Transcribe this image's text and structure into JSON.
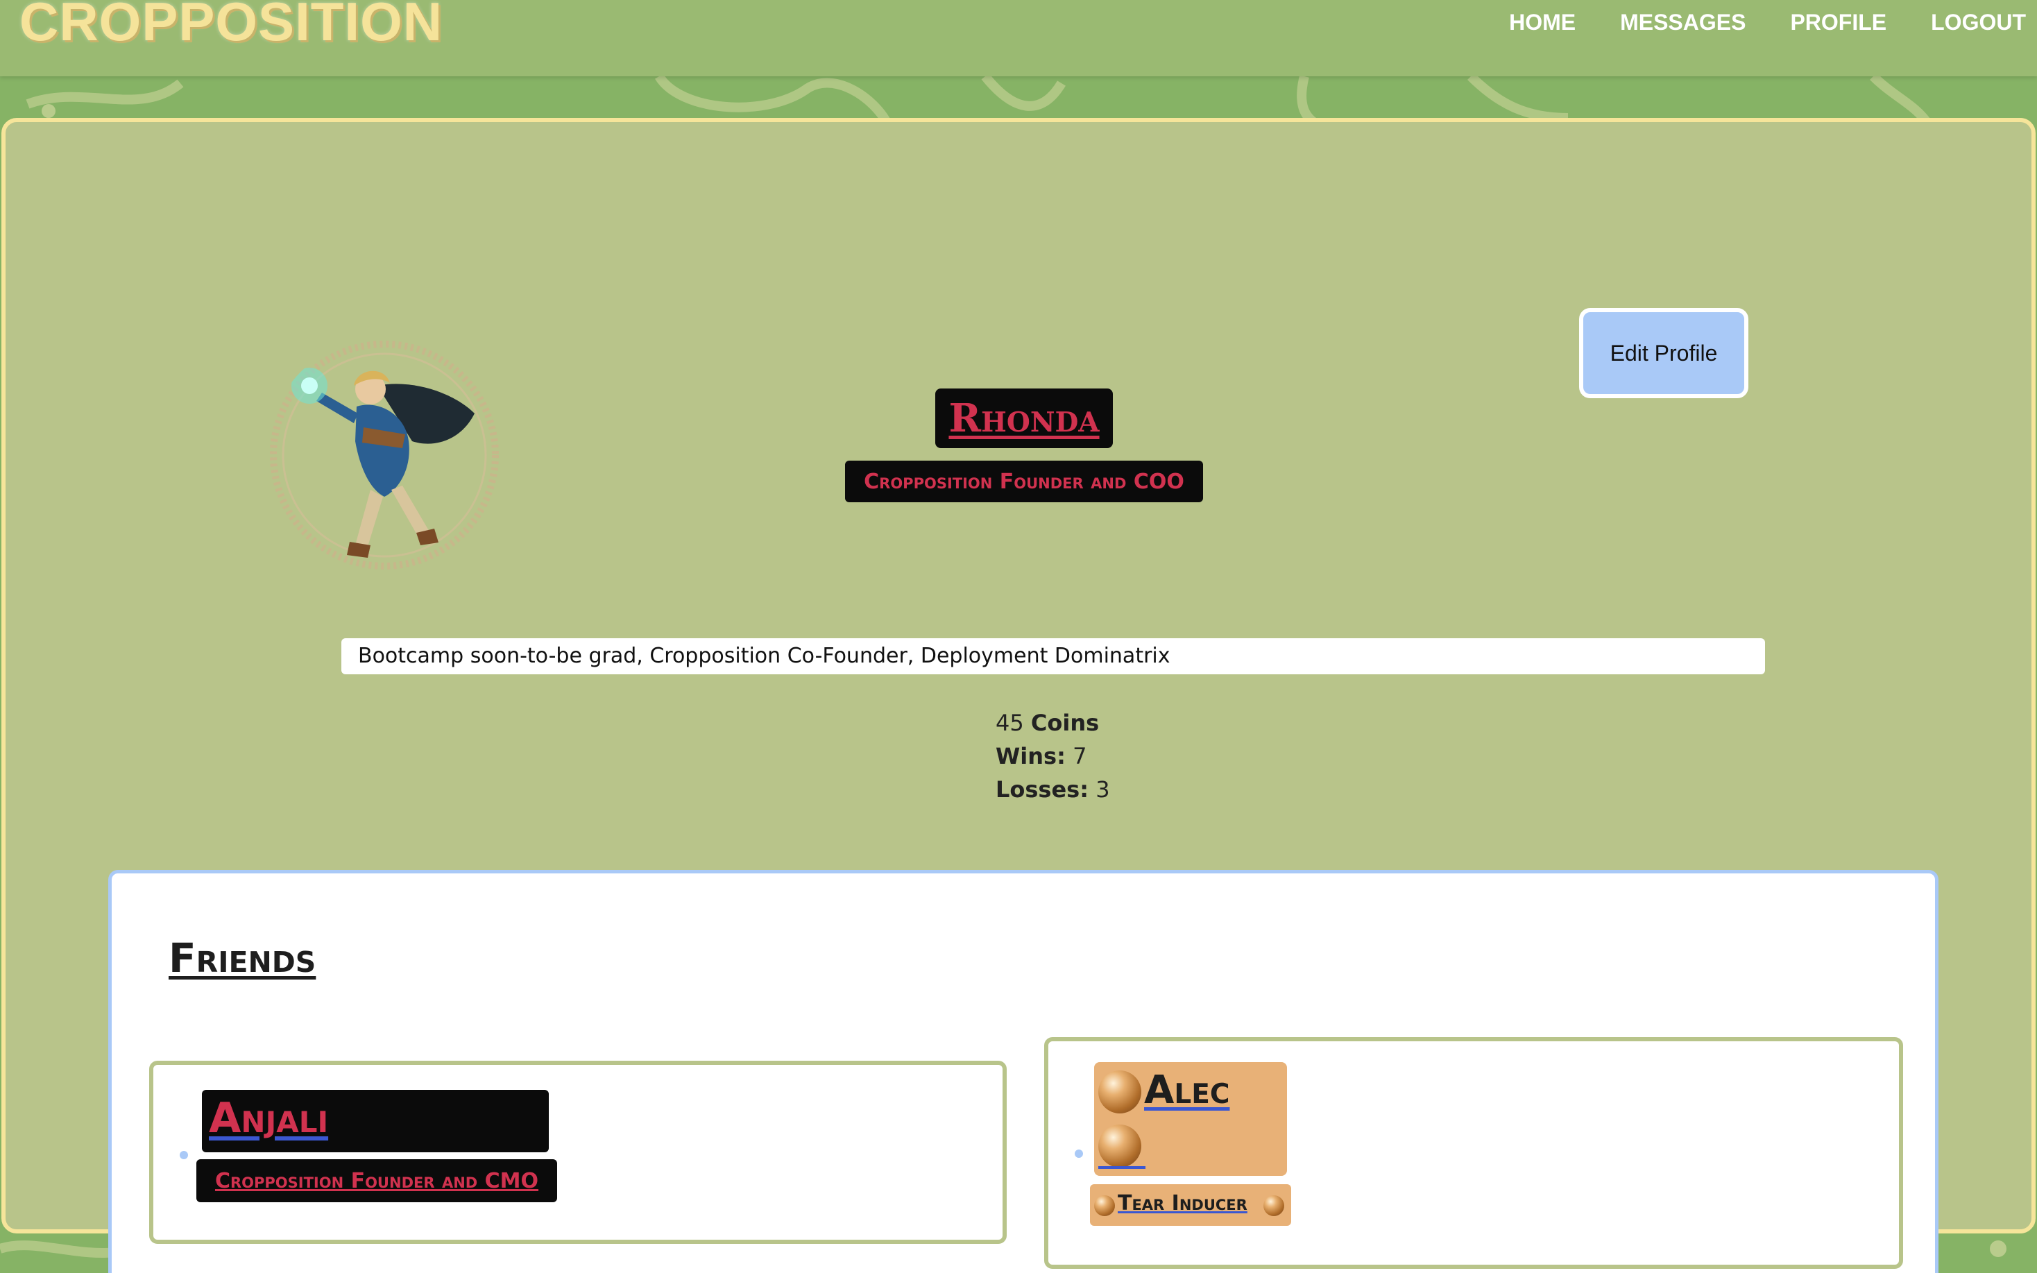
{
  "brand": "CROPPOSITION",
  "nav": {
    "home": "HOME",
    "messages": "MESSAGES",
    "profile": "PROFILE",
    "logout": "LOGOUT"
  },
  "profile": {
    "name": "Rhonda",
    "title": "Cropposition Founder and COO",
    "edit_label": "Edit Profile",
    "bio": "Bootcamp soon-to-be grad, Cropposition Co-Founder, Deployment Dominatrix",
    "coins_value": "45",
    "coins_label": "Coins",
    "wins_label": "Wins:",
    "wins_value": "7",
    "losses_label": "Losses:",
    "losses_value": "3"
  },
  "friends": {
    "heading": "Friends",
    "items": [
      {
        "name": "Anjali",
        "title": "Cropposition Founder and CMO"
      },
      {
        "name": "Alec",
        "title": "Tear Inducer"
      }
    ]
  },
  "colors": {
    "background": "#86b365",
    "navbar": "#9aba72",
    "brand": "#f5e39a",
    "card": "#b8c48a",
    "card_border": "#f6e59a",
    "accent_red": "#d1324f",
    "edit_button": "#a9c9f7",
    "alec_badge": "#e8b177"
  },
  "icons": {
    "avatar": "hero-avatar-icon",
    "orb": "orb-icon"
  }
}
